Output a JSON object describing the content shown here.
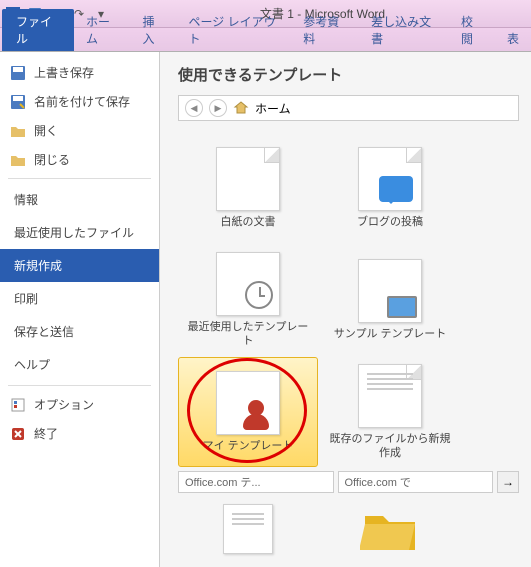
{
  "title": "文書 1 - Microsoft Word",
  "tabs": {
    "file": "ファイル",
    "home": "ホーム",
    "insert": "挿入",
    "layout": "ページ レイアウト",
    "references": "参考資料",
    "mailings": "差し込み文書",
    "review": "校閲",
    "view": "表"
  },
  "sidebar": {
    "save": "上書き保存",
    "saveas": "名前を付けて保存",
    "open": "開く",
    "close": "閉じる",
    "info": "情報",
    "recent": "最近使用したファイル",
    "new": "新規作成",
    "print": "印刷",
    "share": "保存と送信",
    "help": "ヘルプ",
    "options": "オプション",
    "exit": "終了"
  },
  "content": {
    "heading": "使用できるテンプレート",
    "breadcrumb_home": "ホーム",
    "templates": {
      "blank": "白紙の文書",
      "blog": "ブログの投稿",
      "recent": "最近使用したテンプレート",
      "sample": "サンプル テンプレート",
      "my": "マイ テンプレート",
      "existing": "既存のファイルから新規作成"
    },
    "office_section": "Office.com テ...",
    "search_placeholder": "Office.com で"
  }
}
